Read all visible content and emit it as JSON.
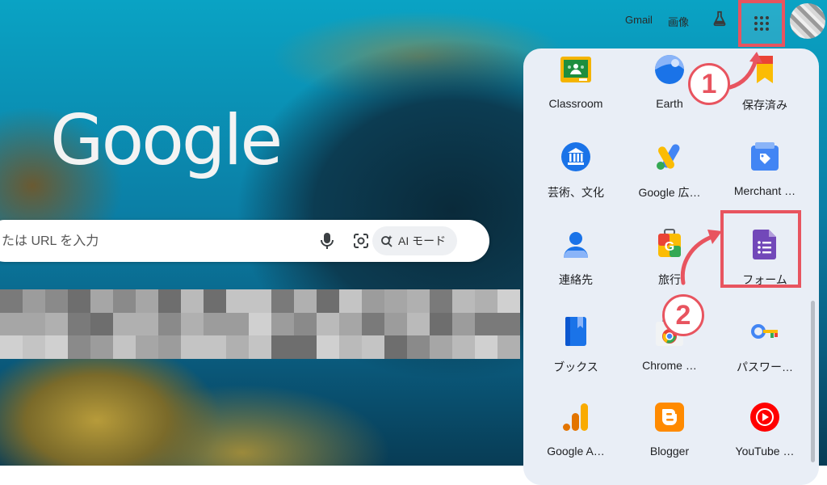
{
  "header": {
    "gmail_label": "Gmail",
    "images_label": "画像"
  },
  "logo_text": "Google",
  "search": {
    "placeholder": "たは URL を入力",
    "ai_mode_label": "AI モード"
  },
  "annotations": {
    "step1": "1",
    "step2": "2",
    "accent_color": "#e8545f"
  },
  "apps": [
    {
      "label": "Classroom",
      "icon": "classroom-icon"
    },
    {
      "label": "Earth",
      "icon": "earth-icon"
    },
    {
      "label": "保存済み",
      "icon": "saved-icon"
    },
    {
      "label": "芸術、文化",
      "icon": "arts-culture-icon"
    },
    {
      "label": "Google 広…",
      "icon": "google-ads-icon"
    },
    {
      "label": "Merchant …",
      "icon": "merchant-center-icon"
    },
    {
      "label": "連絡先",
      "icon": "contacts-icon"
    },
    {
      "label": "旅行",
      "icon": "travel-icon"
    },
    {
      "label": "フォーム",
      "icon": "forms-icon"
    },
    {
      "label": "ブックス",
      "icon": "books-icon"
    },
    {
      "label": "Chrome …",
      "icon": "chrome-web-store-icon"
    },
    {
      "label": "パスワー…",
      "icon": "password-manager-icon"
    },
    {
      "label": "Google A…",
      "icon": "google-analytics-icon"
    },
    {
      "label": "Blogger",
      "icon": "blogger-icon"
    },
    {
      "label": "YouTube …",
      "icon": "youtube-music-icon"
    }
  ]
}
